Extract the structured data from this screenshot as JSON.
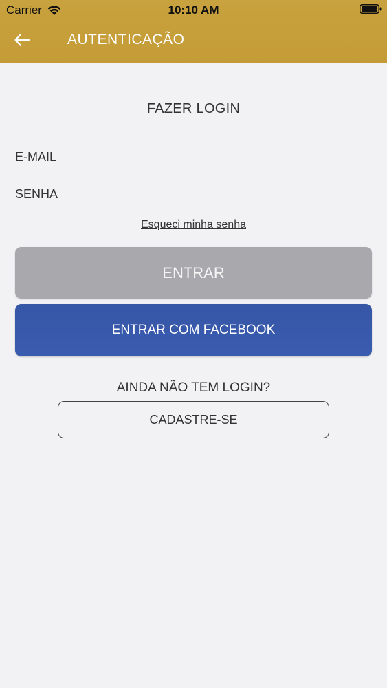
{
  "status_bar": {
    "carrier": "Carrier",
    "time": "10:10 AM"
  },
  "header": {
    "title": "AUTENTICAÇÃO",
    "back_icon": "arrow-left-icon",
    "background_color": "#c69f3a"
  },
  "login": {
    "title": "FAZER LOGIN",
    "email_placeholder": "E-MAIL",
    "password_placeholder": "SENHA",
    "forgot_label": "Esqueci minha senha",
    "submit_label": "ENTRAR",
    "facebook_label": "ENTRAR COM FACEBOOK",
    "submit_color": "#a9a8ac",
    "facebook_color": "#3758aa"
  },
  "register": {
    "question": "AINDA NÃO TEM LOGIN?",
    "button_label": "CADASTRE-SE"
  }
}
